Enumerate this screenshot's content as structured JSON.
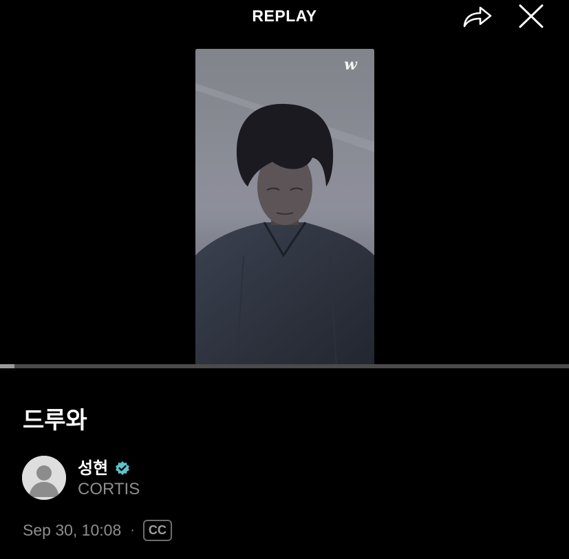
{
  "header": {
    "title": "REPLAY",
    "share_icon": "share-arrow-icon",
    "close_icon": "close-x-icon"
  },
  "video": {
    "watermark_icon": "weverse-logo-icon",
    "progress_fraction": 0.025
  },
  "post": {
    "title": "드루와",
    "artist_name": "성현",
    "verified_icon": "verified-badge-icon",
    "group": "CORTIS",
    "date": "Sep 30, 10:08",
    "separator": "·",
    "cc_label": "CC"
  },
  "colors": {
    "background": "#000000",
    "accent_verified": "#5bc4cc",
    "muted_text": "#8e8e8e"
  }
}
